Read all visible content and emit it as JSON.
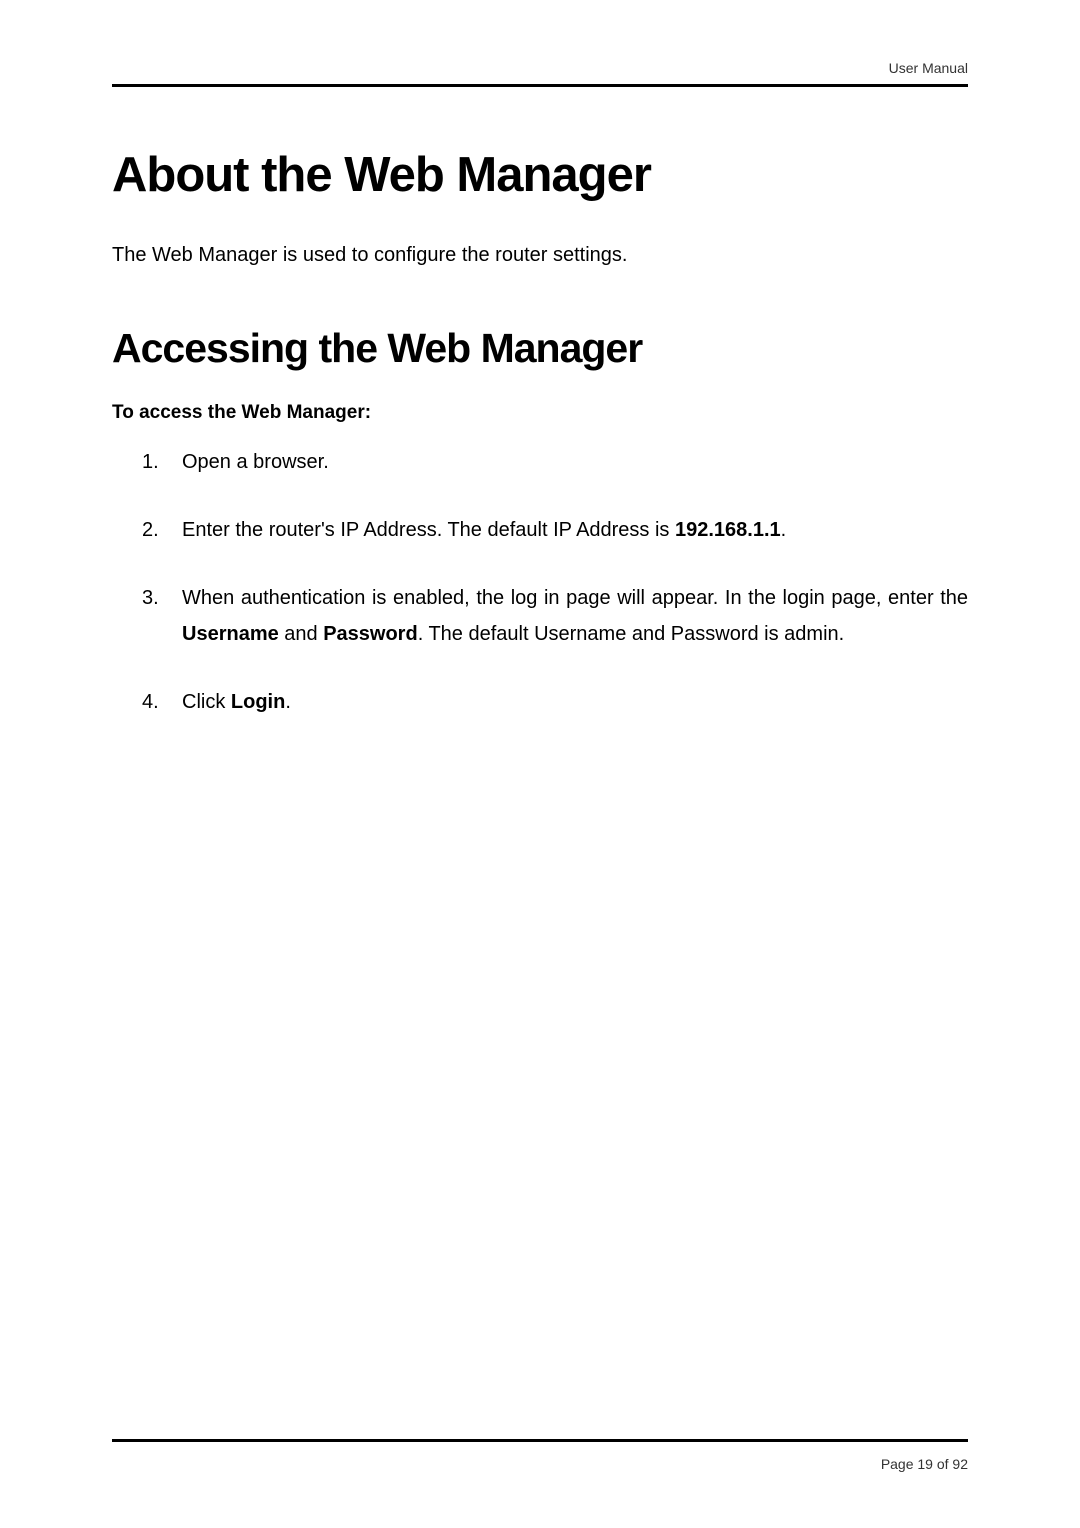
{
  "header": {
    "label": "User Manual"
  },
  "heading1": "About the Web Manager",
  "intro": "The Web Manager is used to configure the router settings.",
  "heading2": "Accessing the Web Manager",
  "heading3": "To access the Web Manager:",
  "steps": {
    "num1": "1.",
    "num2": "2.",
    "num3": "3.",
    "num4": "4.",
    "step1": "Open a browser.",
    "step2_prefix": "Enter the router's IP Address. The default IP Address is ",
    "step2_bold": "192.168.1.1",
    "step2_suffix": ".",
    "step3_part1": "When authentication is enabled, the log in page will appear. In the login page, enter the ",
    "step3_bold1": "Username",
    "step3_part2": " and ",
    "step3_bold2": "Password",
    "step3_part3": ". The default Username and Password is admin.",
    "step4_prefix": "Click ",
    "step4_bold": "Login",
    "step4_suffix": "."
  },
  "footer": {
    "pageText": "Page 19 of 92"
  }
}
